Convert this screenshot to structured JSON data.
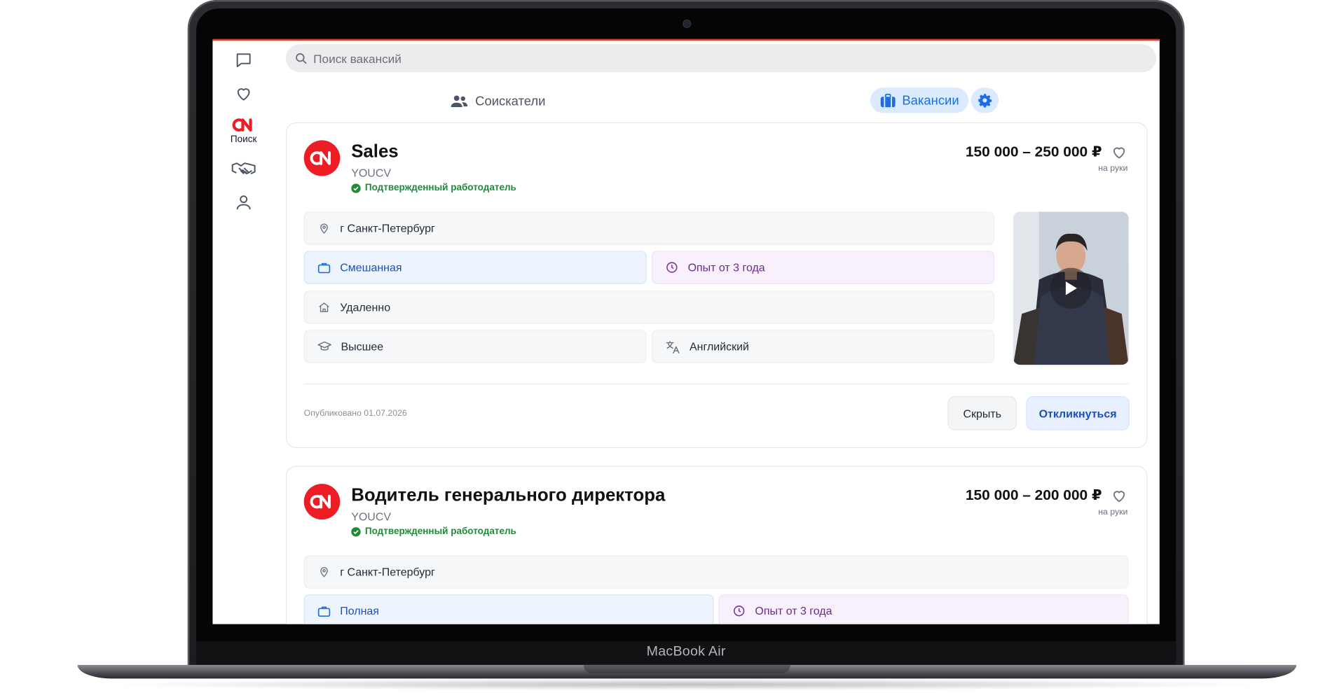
{
  "device": {
    "label": "MacBook Air"
  },
  "sidebar": {
    "items": [
      {
        "name": "messages",
        "label": ""
      },
      {
        "name": "favorites",
        "label": ""
      },
      {
        "name": "search",
        "label": "Поиск"
      },
      {
        "name": "deals",
        "label": ""
      },
      {
        "name": "profile",
        "label": ""
      }
    ]
  },
  "search": {
    "placeholder": "Поиск вакансий",
    "value": ""
  },
  "tabs": {
    "seekers": "Соискатели",
    "vacancies": "Вакансии"
  },
  "colors": {
    "accent": "#1d6fe0",
    "brand": "#ec1d24",
    "verified": "#1f8a3a"
  },
  "jobs": [
    {
      "title": "Sales",
      "company": "YOUCV",
      "verified": "Подтвержденный работодатель",
      "salary": "150 000 – 250 000 ₽",
      "salary_note": "на руки",
      "location": "г Санкт-Петербург",
      "employment": "Смешанная",
      "experience": "Опыт от 3 года",
      "work_format": "Удаленно",
      "education": "Высшее",
      "language": "Английский",
      "published": "Опубликовано 01.07.2026",
      "hide_label": "Скрыть",
      "apply_label": "Откликнуться"
    },
    {
      "title": "Водитель генерального директора",
      "company": "YOUCV",
      "verified": "Подтвержденный работодатель",
      "salary": "150 000 – 200 000 ₽",
      "salary_note": "на руки",
      "location": "г Санкт-Петербург",
      "employment": "Полная",
      "experience": "Опыт от 3 года"
    }
  ]
}
